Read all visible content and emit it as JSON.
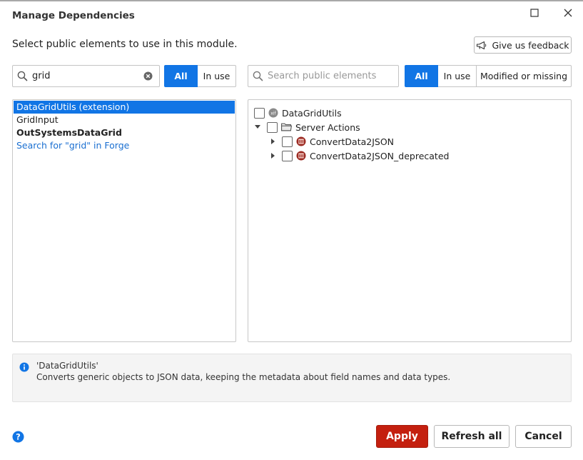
{
  "window": {
    "title": "Manage Dependencies"
  },
  "subtitle": "Select public elements to use in this module.",
  "feedback_button": {
    "label": "Give us feedback"
  },
  "left": {
    "search": {
      "value": "grid",
      "placeholder": ""
    },
    "filters": [
      {
        "label": "All",
        "active": true
      },
      {
        "label": "In use",
        "active": false
      }
    ],
    "items": [
      {
        "label": "DataGridUtils  (extension)",
        "selected": true,
        "bold": false,
        "link": false
      },
      {
        "label": "GridInput",
        "selected": false,
        "bold": false,
        "link": false
      },
      {
        "label": "OutSystemsDataGrid",
        "selected": false,
        "bold": true,
        "link": false
      },
      {
        "label": "Search for \"grid\" in Forge",
        "selected": false,
        "bold": false,
        "link": true
      }
    ]
  },
  "right": {
    "search": {
      "value": "",
      "placeholder": "Search public elements"
    },
    "filters": [
      {
        "label": "All",
        "active": true
      },
      {
        "label": "In use",
        "active": false
      },
      {
        "label": "Modified or missing",
        "active": false
      }
    ],
    "tree": {
      "root": {
        "label": "DataGridUtils",
        "icon": "extension-icon",
        "icon_text": "xif"
      },
      "folder": {
        "label": "Server Actions",
        "icon": "folder-icon"
      },
      "actions": [
        {
          "label": "ConvertData2JSON",
          "icon": "server-action-icon"
        },
        {
          "label": "ConvertData2JSON_deprecated",
          "icon": "server-action-icon"
        }
      ]
    }
  },
  "info": {
    "title": "'DataGridUtils'",
    "description": "Converts generic objects to JSON data, keeping the metadata about field names and data types."
  },
  "buttons": {
    "apply": "Apply",
    "refresh": "Refresh all",
    "cancel": "Cancel"
  },
  "colors": {
    "accent": "#1175e5",
    "apply": "#c4200f",
    "link": "#1a6fd1",
    "info_icon": "#1175e5"
  }
}
